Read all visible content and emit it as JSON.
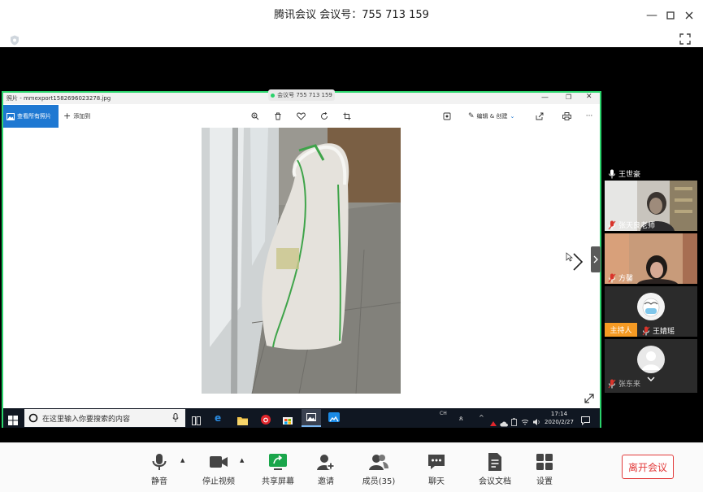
{
  "window": {
    "title": "腾讯会议 会议号：755 713 159"
  },
  "share": {
    "tag": "会议号 755 713 159",
    "photos_title": "照片 - mmexport1582696023278.jpg",
    "view_all": "查看所有照片",
    "add_to": "添加到",
    "edit_create": "编辑 & 创建"
  },
  "taskbar": {
    "search_placeholder": "在这里输入你要搜索的内容",
    "lang": "CH",
    "time": "17:14",
    "date": "2020/2/27"
  },
  "participants": [
    {
      "name": "王世豪",
      "muted": false
    },
    {
      "name": "张天良老师",
      "muted": true
    },
    {
      "name": "方馨",
      "muted": true
    },
    {
      "name": "王婧瑶",
      "muted": true,
      "host_badge": "主持人"
    },
    {
      "name": "张东来",
      "muted": true
    }
  ],
  "toolbar": {
    "mute": "静音",
    "stop_video": "停止视频",
    "share_screen": "共享屏幕",
    "invite": "邀请",
    "members": "成员(35)",
    "chat": "聊天",
    "docs": "会议文档",
    "settings": "设置",
    "leave": "离开会议"
  },
  "colors": {
    "accent_green": "#2ad36b",
    "leave_red": "#e23a3a",
    "mute_red": "#d9342b",
    "host_orange": "#f59a23"
  }
}
